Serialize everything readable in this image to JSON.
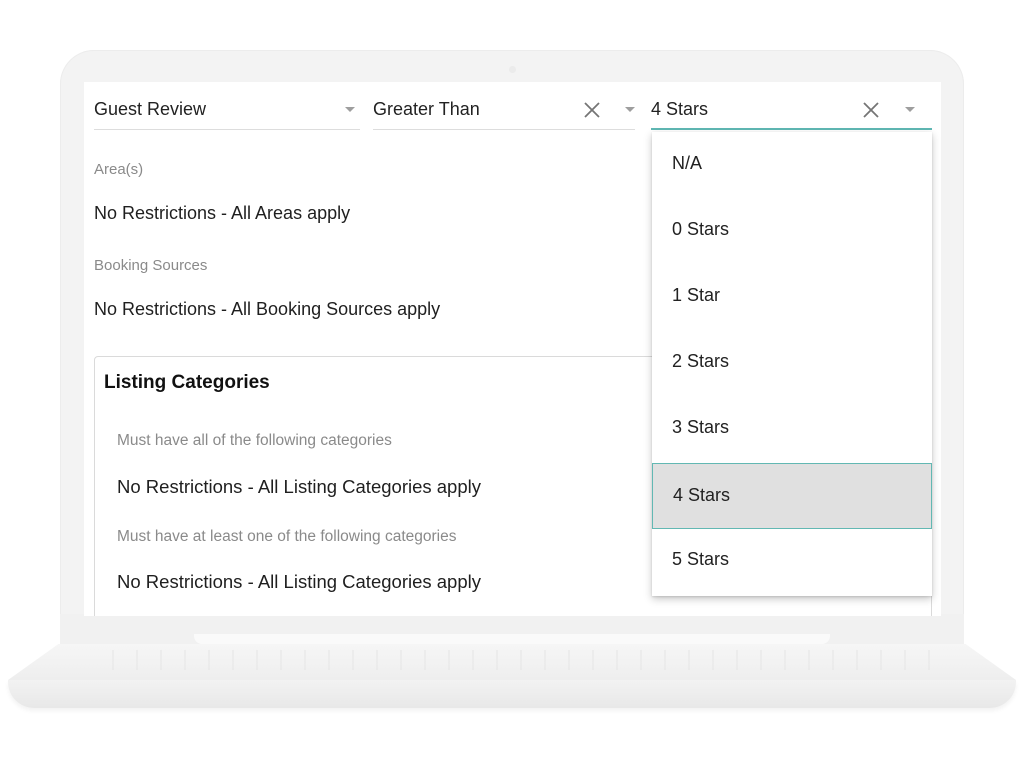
{
  "filter": {
    "field": "Guest Review",
    "operator": "Greater Than",
    "value": "4 Stars"
  },
  "areas": {
    "label": "Area(s)",
    "value": "No Restrictions - All Areas apply"
  },
  "booking_sources": {
    "label": "Booking Sources",
    "value": "No Restrictions - All Booking Sources apply"
  },
  "listing_categories": {
    "title": "Listing Categories",
    "must_have_all_label": "Must have all of the following categories",
    "must_have_all_value": "No Restrictions - All Listing Categories apply",
    "at_least_one_label": "Must have at least one of the following categories",
    "at_least_one_value": "No Restrictions - All Listing Categories apply"
  },
  "rating_dropdown": {
    "options": [
      "N/A",
      "0 Stars",
      "1 Star",
      "2 Stars",
      "3 Stars",
      "4 Stars",
      "5 Stars"
    ],
    "selected": "4 Stars"
  },
  "colors": {
    "accent": "#5fb8b4",
    "selected_bg": "#e0e0e0"
  },
  "icons": [
    "chevron-down-icon",
    "close-icon"
  ]
}
